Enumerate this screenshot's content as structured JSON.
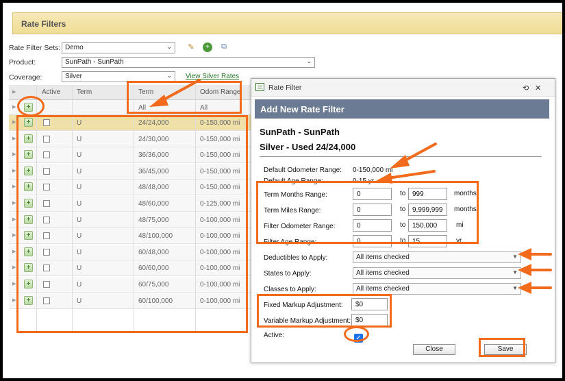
{
  "panel": {
    "title": "Rate Filters"
  },
  "form": {
    "rate_filter_sets_label": "Rate Filter Sets:",
    "rate_filter_sets_value": "Demo",
    "product_label": "Product:",
    "product_value": "SunPath - SunPath",
    "coverage_label": "Coverage:",
    "coverage_value": "Silver",
    "view_rates_link": "View Silver Rates"
  },
  "grid": {
    "columns": {
      "active": "Active",
      "term1": "Term",
      "term2": "Term",
      "odom": "Odom Range"
    },
    "filter": {
      "term": "All",
      "odom": "All"
    },
    "rows": [
      {
        "col1": "U",
        "term": "24/24,000",
        "odom": "0-150,000 mi"
      },
      {
        "col1": "U",
        "term": "24/30,000",
        "odom": "0-150,000 mi"
      },
      {
        "col1": "U",
        "term": "36/36,000",
        "odom": "0-150,000 mi"
      },
      {
        "col1": "U",
        "term": "36/45,000",
        "odom": "0-150,000 mi"
      },
      {
        "col1": "U",
        "term": "48/48,000",
        "odom": "0-150,000 mi"
      },
      {
        "col1": "U",
        "term": "48/60,000",
        "odom": "0-125,000 mi"
      },
      {
        "col1": "U",
        "term": "48/75,000",
        "odom": "0-100,000 mi"
      },
      {
        "col1": "U",
        "term": "48/100,000",
        "odom": "0-100,000 mi"
      },
      {
        "col1": "U",
        "term": "60/48,000",
        "odom": "0-100,000 mi"
      },
      {
        "col1": "U",
        "term": "60/60,000",
        "odom": "0-100,000 mi"
      },
      {
        "col1": "U",
        "term": "60/75,000",
        "odom": "0-100,000 mi"
      },
      {
        "col1": "U",
        "term": "60/100,000",
        "odom": "0-100,000 mi"
      }
    ]
  },
  "dialog": {
    "window_title": "Rate Filter",
    "header": "Add New Rate Filter",
    "line1": "SunPath - SunPath",
    "line2": "Silver - Used 24/24,000",
    "default_odometer_label": "Default Odometer Range:",
    "default_odometer_value": "0-150,000 mi",
    "default_age_label": "Default Age Range:",
    "default_age_value": "0-15 yr",
    "term_months_label": "Term Months Range:",
    "term_months_from": "0",
    "term_months_to": "999",
    "term_months_unit": "months",
    "term_miles_label": "Term Miles Range:",
    "term_miles_from": "0",
    "term_miles_to": "9,999,999",
    "term_miles_unit": "months",
    "filter_odometer_label": "Filter Odometer Range:",
    "filter_odometer_from": "0",
    "filter_odometer_to": "150,000",
    "filter_odometer_unit": "mi",
    "filter_age_label": "Filter Age Range:",
    "filter_age_from": "0",
    "filter_age_to": "15",
    "filter_age_unit": "yr",
    "to_label": "to",
    "deductibles_label": "Deductibles to Apply:",
    "deductibles_value": "All items checked",
    "states_label": "States to Apply:",
    "states_value": "All items checked",
    "classes_label": "Classes to Apply:",
    "classes_value": "All items checked",
    "fixed_markup_label": "Fixed Markup Adjustment:",
    "fixed_markup_value": "$0",
    "variable_markup_label": "Variable Markup Adjustment:",
    "variable_markup_value": "$0",
    "active_label": "Active:",
    "active_checked": true,
    "close_label": "Close",
    "save_label": "Save"
  },
  "colors": {
    "annotation": "#f26a1b",
    "dialog_header": "#6b7b94",
    "panel_title_bg": "#efdc96",
    "selected_row": "#efdfa9"
  }
}
